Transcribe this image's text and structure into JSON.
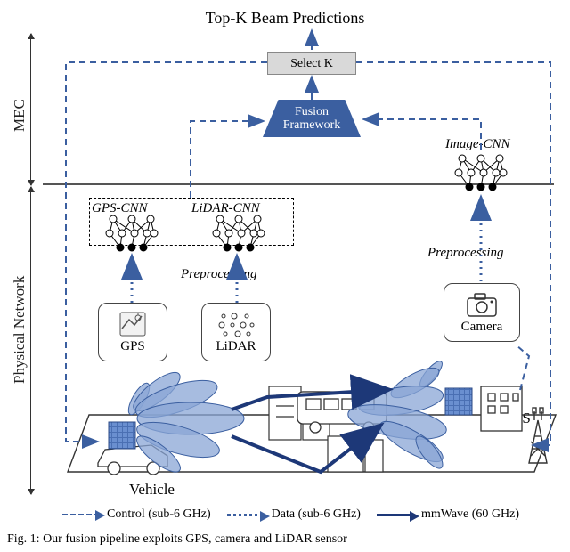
{
  "title": "Top-K Beam Predictions",
  "sections": {
    "mec": "MEC",
    "physical": "Physical Network"
  },
  "blocks": {
    "select_k": "Select K",
    "fusion_line1": "Fusion",
    "fusion_line2": "Framework"
  },
  "cnn_labels": {
    "gps": "GPS-CNN",
    "lidar": "LiDAR-CNN",
    "image": "Image-CNN"
  },
  "preprocessing": "Preprocessing",
  "sensors": {
    "gps": "GPS",
    "lidar": "LiDAR",
    "camera": "Camera"
  },
  "scene": {
    "vehicle": "Vehicle",
    "bs": "BS"
  },
  "legend": {
    "control": "Control (sub-6 GHz)",
    "data": "Data (sub-6 GHz)",
    "mmwave": "mmWave (60 GHz)"
  },
  "caption": "Fig. 1: Our fusion pipeline exploits GPS, camera and LiDAR sensor"
}
